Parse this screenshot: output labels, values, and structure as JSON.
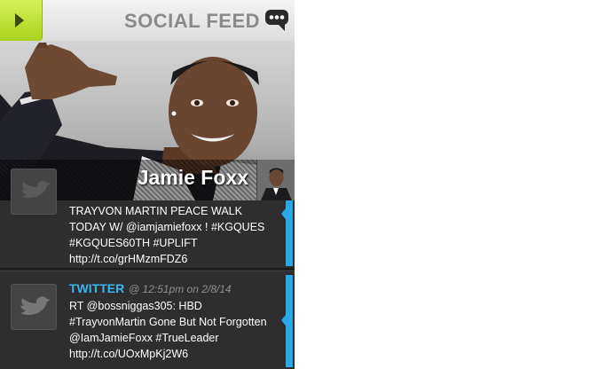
{
  "header": {
    "title": "SOCIAL FEED",
    "menu_icon": "triangle-right-icon",
    "chat_icon": "speech-bubble-icon",
    "accent_color": "#b5dc2a"
  },
  "hero": {
    "name": "Jamie Foxx"
  },
  "feed": {
    "items": [
      {
        "text": "TRAYVON MARTIN PEACE WALK\nTODAY W/ @iamjamiefoxx ! #KGQUES\n#KGQUES60TH #UPLIFT\nhttp://t.co/grHMzmFDZ6"
      },
      {
        "source": "TWITTER",
        "meta": "@ 12:51pm on 2/8/14",
        "text": "RT @bossniggas305: HBD\n#TrayvonMartin Gone But Not Forgotten\n@IamJamieFoxx #TrueLeader\nhttp://t.co/UOxMpKj2W6"
      }
    ],
    "link_color": "#35b7f2"
  }
}
